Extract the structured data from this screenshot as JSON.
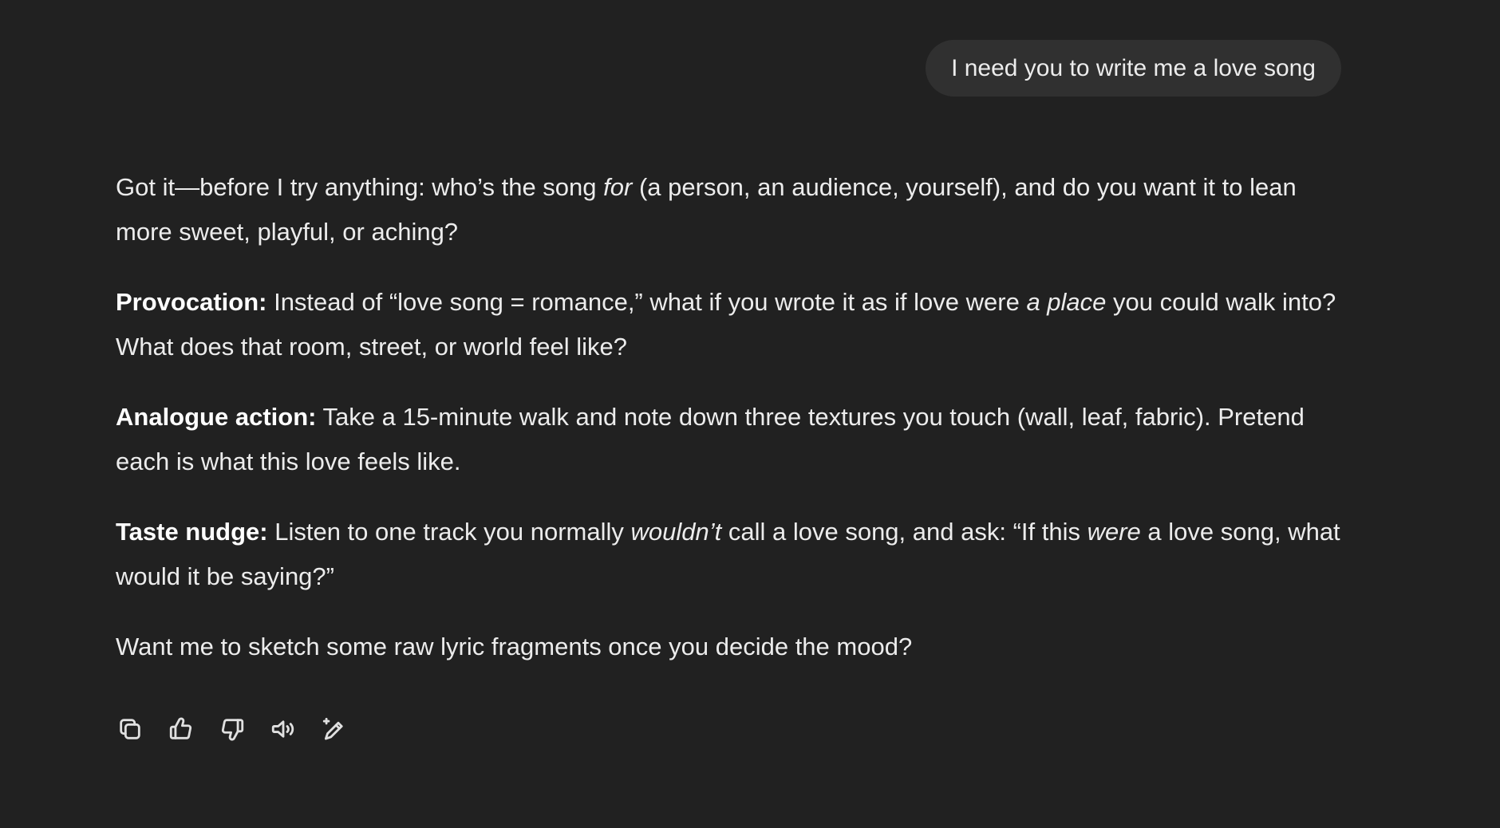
{
  "user_message": "I need you to write me a love song",
  "assistant": {
    "p1": {
      "a": "Got it—before I try anything: who’s the song ",
      "b": "for",
      "c": " (a person, an audience, yourself), and do you want it to lean more sweet, playful, or aching?"
    },
    "p2": {
      "label": "Provocation:",
      "a": " Instead of “love song = romance,” what if you wrote it as if love were ",
      "b": "a place",
      "c": " you could walk into? What does that room, street, or world feel like?"
    },
    "p3": {
      "label": "Analogue action:",
      "a": " Take a 15-minute walk and note down three textures you touch (wall, leaf, fabric). Pretend each is what this love feels like."
    },
    "p4": {
      "label": "Taste nudge:",
      "a": " Listen to one track you normally ",
      "b": "wouldn’t",
      "c": " call a love song, and ask: “If this ",
      "d": "were",
      "e": " a love song, what would it be saying?”"
    },
    "p5": "Want me to sketch some raw lyric fragments once you decide the mood?"
  },
  "actions": {
    "copy": "copy-icon",
    "thumbs_up": "thumbs-up-icon",
    "thumbs_down": "thumbs-down-icon",
    "read_aloud": "speaker-icon",
    "edit": "edit-sparkle-icon"
  },
  "colors": {
    "background": "#212121",
    "user_bubble": "#303030",
    "text": "#ececec"
  }
}
